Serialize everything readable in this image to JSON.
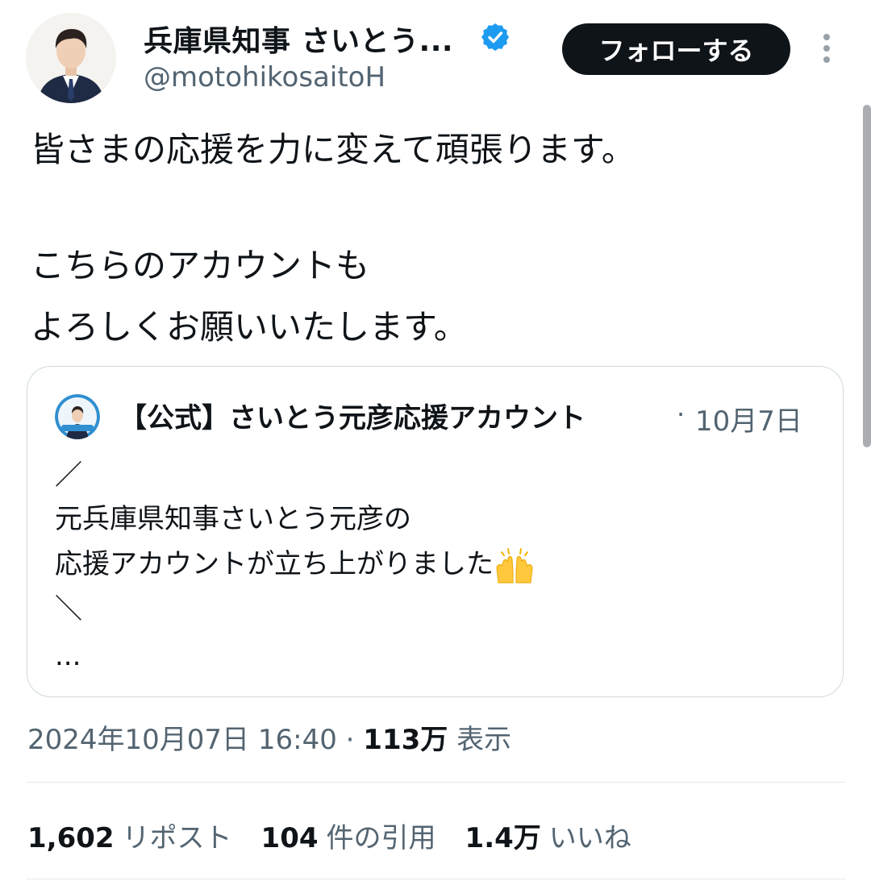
{
  "author": {
    "name": "兵庫県知事 さいとう...",
    "handle": "@motohikosaitoH",
    "verified_icon": "verified-badge-icon",
    "verified_color": "#1d9bf0"
  },
  "follow_button": {
    "label": "フォローする"
  },
  "more_icon": "more-vertical-icon",
  "post": {
    "lines": [
      "皆さまの応援を力に変えて頑張ります。",
      "こちらのアカウントも",
      "よろしくお願いいたします。"
    ]
  },
  "quote": {
    "author": "【公式】さいとう元彦応援アカウント",
    "separator": "·",
    "date": "10月7日",
    "lines": [
      "／",
      "元兵庫県知事さいとう元彦の",
      "応援アカウントが立ち上がりました",
      "＼",
      "..."
    ],
    "emoji": "raising-hands-emoji"
  },
  "meta": {
    "timestamp": "2024年10月07日 16:40",
    "separator": "·",
    "views_count": "113万",
    "views_label": "表示"
  },
  "stats": {
    "reposts_count": "1,602",
    "reposts_label": "リポスト",
    "quotes_count": "104",
    "quotes_label": "件の引用",
    "likes_count": "1.4万",
    "likes_label": "いいね"
  }
}
